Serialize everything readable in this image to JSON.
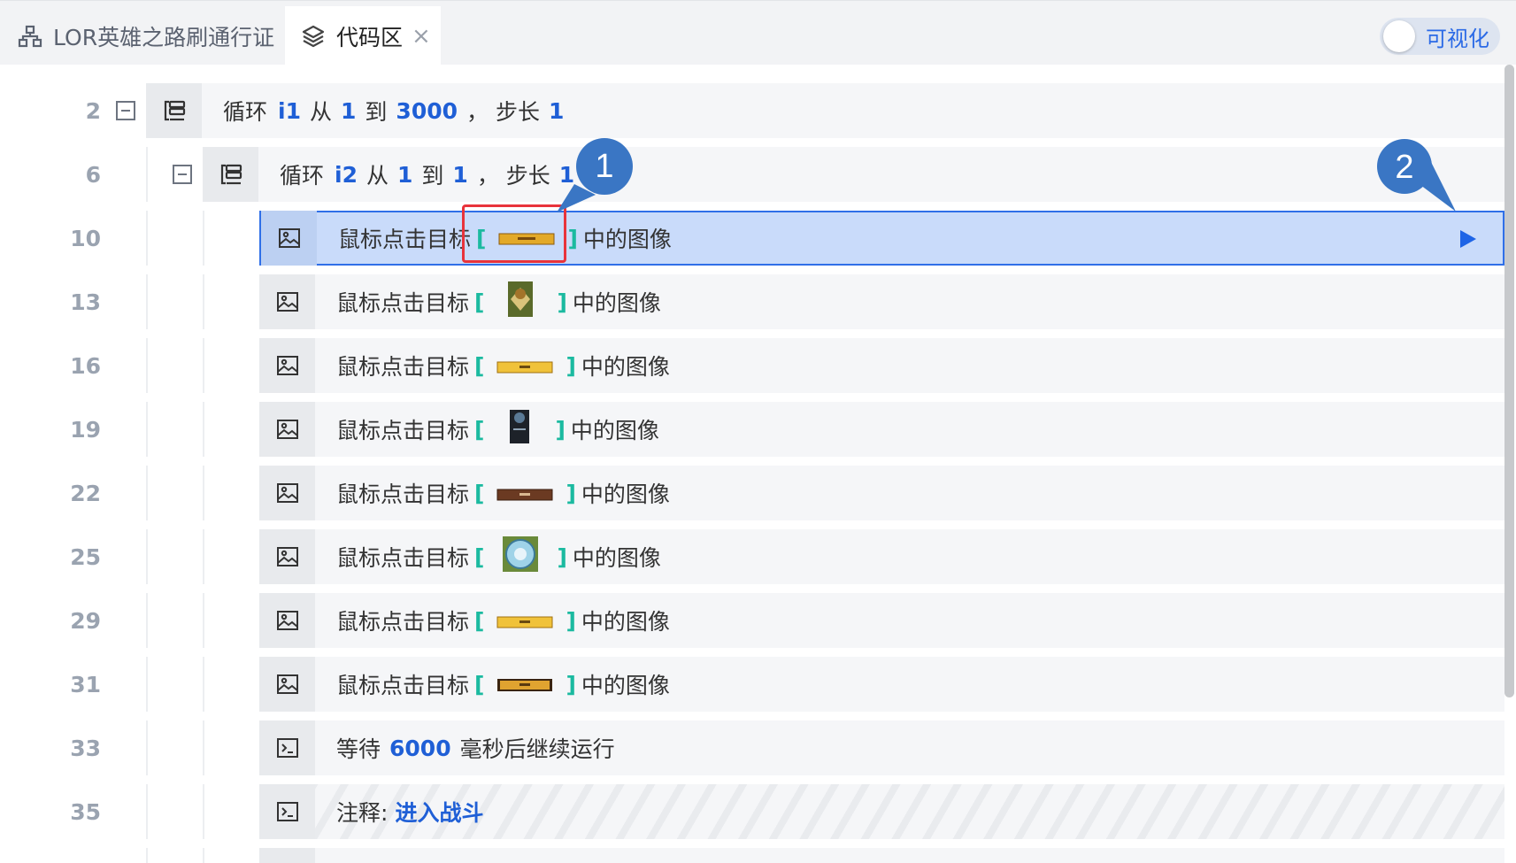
{
  "tabs": {
    "project_label": "LOR英雄之路刷通行证",
    "code_label": "代码区",
    "close_glyph": "×",
    "toggle_label": "可视化"
  },
  "rows": [
    {
      "line": "2",
      "prefix": "循环",
      "var": "i1",
      "from_word": "从",
      "from": "1",
      "to_word": "到",
      "to": "3000",
      "step_word": "，  步长",
      "step": "1"
    },
    {
      "line": "6",
      "prefix": "循环",
      "var": "i2",
      "from_word": "从",
      "from": "1",
      "to_word": "到",
      "to": "1",
      "step_word": "，  步长",
      "step": "1"
    },
    {
      "line": "10",
      "prefix": "鼠标点击目标",
      "open": "[",
      "close": "]",
      "suffix": "中的图像"
    },
    {
      "line": "13",
      "prefix": "鼠标点击目标",
      "open": "[",
      "close": "]",
      "suffix": "中的图像"
    },
    {
      "line": "16",
      "prefix": "鼠标点击目标",
      "open": "[",
      "close": "]",
      "suffix": "中的图像"
    },
    {
      "line": "19",
      "prefix": "鼠标点击目标",
      "open": "[",
      "close": "]",
      "suffix": "中的图像"
    },
    {
      "line": "22",
      "prefix": "鼠标点击目标",
      "open": "[",
      "close": "]",
      "suffix": "中的图像"
    },
    {
      "line": "25",
      "prefix": "鼠标点击目标",
      "open": "[",
      "close": "]",
      "suffix": "中的图像"
    },
    {
      "line": "29",
      "prefix": "鼠标点击目标",
      "open": "[",
      "close": "]",
      "suffix": "中的图像"
    },
    {
      "line": "31",
      "prefix": "鼠标点击目标",
      "open": "[",
      "close": "]",
      "suffix": "中的图像"
    },
    {
      "line": "33",
      "prefix": "等待",
      "value": "6000",
      "suffix": "毫秒后继续运行"
    },
    {
      "line": "35",
      "prefix": "注释:",
      "value": "进入战斗"
    }
  ],
  "callouts": {
    "one": "1",
    "two": "2"
  },
  "colors": {
    "accent": "#2f6fe8",
    "keyword": "#1f5fd6",
    "bracket": "#1bbaa0",
    "highlight": "#e8333b",
    "callout": "#3a76c4"
  },
  "icons": [
    "hierarchy-icon",
    "layers-icon",
    "loop-icon",
    "image-icon",
    "terminal-icon",
    "play-icon"
  ]
}
